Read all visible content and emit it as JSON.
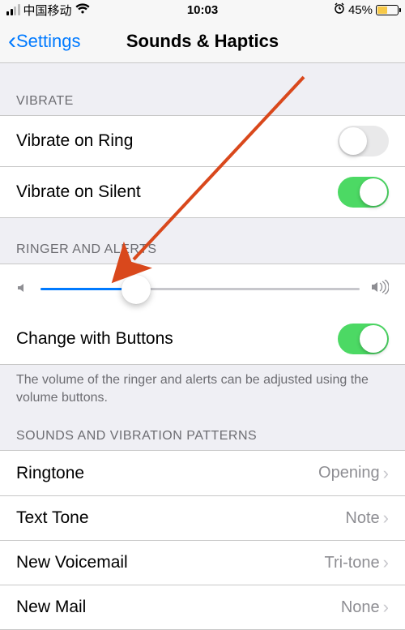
{
  "status": {
    "carrier": "中国移动",
    "time": "10:03",
    "battery_pct": "45%"
  },
  "nav": {
    "back_label": "Settings",
    "title": "Sounds & Haptics"
  },
  "sections": {
    "vibrate_header": "VIBRATE",
    "ringer_header": "RINGER AND ALERTS",
    "sounds_header": "SOUNDS AND VIBRATION PATTERNS",
    "ringer_footer": "The volume of the ringer and alerts can be adjusted using the volume buttons."
  },
  "rows": {
    "vibrate_ring": {
      "label": "Vibrate on Ring",
      "on": false
    },
    "vibrate_silent": {
      "label": "Vibrate on Silent",
      "on": true
    },
    "change_buttons": {
      "label": "Change with Buttons",
      "on": true
    },
    "ringtone": {
      "label": "Ringtone",
      "value": "Opening"
    },
    "text_tone": {
      "label": "Text Tone",
      "value": "Note"
    },
    "new_voicemail": {
      "label": "New Voicemail",
      "value": "Tri-tone"
    },
    "new_mail": {
      "label": "New Mail",
      "value": "None"
    }
  },
  "slider": {
    "percent": 30
  }
}
